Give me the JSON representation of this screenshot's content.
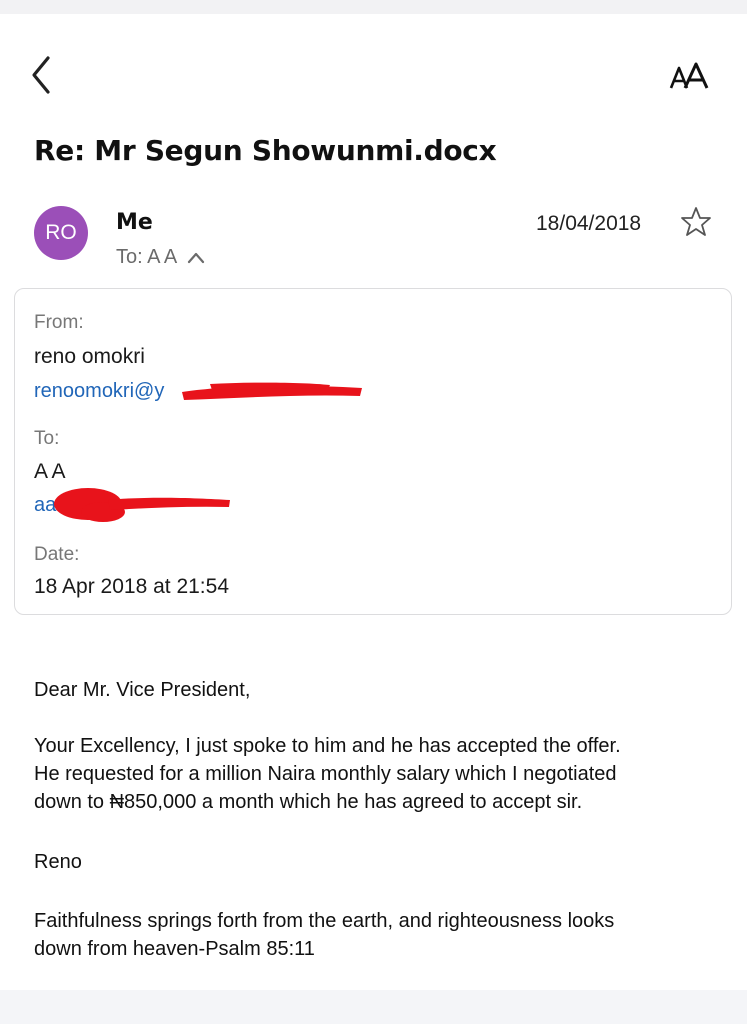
{
  "header": {
    "back_icon": "chevron-left-icon",
    "text_size_icon": "text-size-icon",
    "subject": "Re: Mr Segun Showunmi.docx"
  },
  "message": {
    "avatar_initials": "RO",
    "avatar_color": "#9b4fb8",
    "sender": "Me",
    "recipients": "To: A A",
    "date": "18/04/2018",
    "star_icon": "star-outline-icon"
  },
  "details": {
    "from_label": "From:",
    "from_name": "reno omokri",
    "from_email_visible": "renoomokri@y",
    "to_label": "To:",
    "to_name": "A A",
    "to_email_visible": "aa",
    "date_label": "Date:",
    "date_value": "18 Apr 2018 at 21:54",
    "redaction_color": "#e8131b"
  },
  "body": {
    "greeting": "Dear Mr. Vice President,",
    "paragraph_lines": [
      "Your Excellency, I just spoke to him and he has accepted the offer.",
      "He requested for a million Naira monthly salary which I negotiated",
      "down to ₦850,000 a month which he has agreed to accept sir."
    ],
    "signoff": "Reno",
    "quote_lines": [
      "Faithfulness springs forth from the earth, and righteousness looks",
      "down from heaven-Psalm 85:11"
    ]
  }
}
